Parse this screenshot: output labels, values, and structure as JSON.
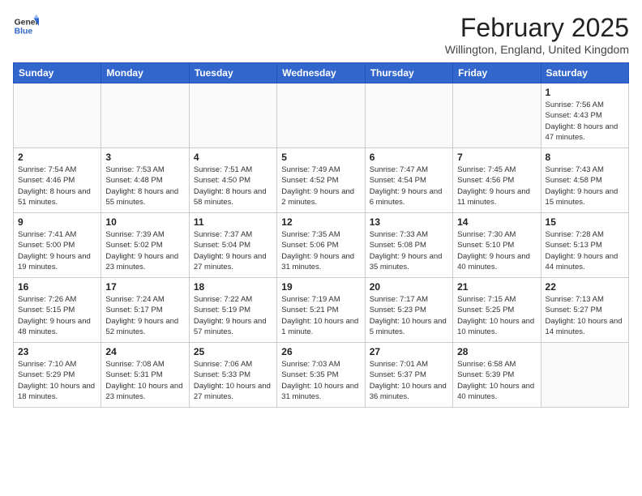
{
  "header": {
    "logo_general": "General",
    "logo_blue": "Blue",
    "title": "February 2025",
    "subtitle": "Willington, England, United Kingdom"
  },
  "days_of_week": [
    "Sunday",
    "Monday",
    "Tuesday",
    "Wednesday",
    "Thursday",
    "Friday",
    "Saturday"
  ],
  "weeks": [
    [
      {
        "day": "",
        "info": ""
      },
      {
        "day": "",
        "info": ""
      },
      {
        "day": "",
        "info": ""
      },
      {
        "day": "",
        "info": ""
      },
      {
        "day": "",
        "info": ""
      },
      {
        "day": "",
        "info": ""
      },
      {
        "day": "1",
        "info": "Sunrise: 7:56 AM\nSunset: 4:43 PM\nDaylight: 8 hours and 47 minutes."
      }
    ],
    [
      {
        "day": "2",
        "info": "Sunrise: 7:54 AM\nSunset: 4:46 PM\nDaylight: 8 hours and 51 minutes."
      },
      {
        "day": "3",
        "info": "Sunrise: 7:53 AM\nSunset: 4:48 PM\nDaylight: 8 hours and 55 minutes."
      },
      {
        "day": "4",
        "info": "Sunrise: 7:51 AM\nSunset: 4:50 PM\nDaylight: 8 hours and 58 minutes."
      },
      {
        "day": "5",
        "info": "Sunrise: 7:49 AM\nSunset: 4:52 PM\nDaylight: 9 hours and 2 minutes."
      },
      {
        "day": "6",
        "info": "Sunrise: 7:47 AM\nSunset: 4:54 PM\nDaylight: 9 hours and 6 minutes."
      },
      {
        "day": "7",
        "info": "Sunrise: 7:45 AM\nSunset: 4:56 PM\nDaylight: 9 hours and 11 minutes."
      },
      {
        "day": "8",
        "info": "Sunrise: 7:43 AM\nSunset: 4:58 PM\nDaylight: 9 hours and 15 minutes."
      }
    ],
    [
      {
        "day": "9",
        "info": "Sunrise: 7:41 AM\nSunset: 5:00 PM\nDaylight: 9 hours and 19 minutes."
      },
      {
        "day": "10",
        "info": "Sunrise: 7:39 AM\nSunset: 5:02 PM\nDaylight: 9 hours and 23 minutes."
      },
      {
        "day": "11",
        "info": "Sunrise: 7:37 AM\nSunset: 5:04 PM\nDaylight: 9 hours and 27 minutes."
      },
      {
        "day": "12",
        "info": "Sunrise: 7:35 AM\nSunset: 5:06 PM\nDaylight: 9 hours and 31 minutes."
      },
      {
        "day": "13",
        "info": "Sunrise: 7:33 AM\nSunset: 5:08 PM\nDaylight: 9 hours and 35 minutes."
      },
      {
        "day": "14",
        "info": "Sunrise: 7:30 AM\nSunset: 5:10 PM\nDaylight: 9 hours and 40 minutes."
      },
      {
        "day": "15",
        "info": "Sunrise: 7:28 AM\nSunset: 5:13 PM\nDaylight: 9 hours and 44 minutes."
      }
    ],
    [
      {
        "day": "16",
        "info": "Sunrise: 7:26 AM\nSunset: 5:15 PM\nDaylight: 9 hours and 48 minutes."
      },
      {
        "day": "17",
        "info": "Sunrise: 7:24 AM\nSunset: 5:17 PM\nDaylight: 9 hours and 52 minutes."
      },
      {
        "day": "18",
        "info": "Sunrise: 7:22 AM\nSunset: 5:19 PM\nDaylight: 9 hours and 57 minutes."
      },
      {
        "day": "19",
        "info": "Sunrise: 7:19 AM\nSunset: 5:21 PM\nDaylight: 10 hours and 1 minute."
      },
      {
        "day": "20",
        "info": "Sunrise: 7:17 AM\nSunset: 5:23 PM\nDaylight: 10 hours and 5 minutes."
      },
      {
        "day": "21",
        "info": "Sunrise: 7:15 AM\nSunset: 5:25 PM\nDaylight: 10 hours and 10 minutes."
      },
      {
        "day": "22",
        "info": "Sunrise: 7:13 AM\nSunset: 5:27 PM\nDaylight: 10 hours and 14 minutes."
      }
    ],
    [
      {
        "day": "23",
        "info": "Sunrise: 7:10 AM\nSunset: 5:29 PM\nDaylight: 10 hours and 18 minutes."
      },
      {
        "day": "24",
        "info": "Sunrise: 7:08 AM\nSunset: 5:31 PM\nDaylight: 10 hours and 23 minutes."
      },
      {
        "day": "25",
        "info": "Sunrise: 7:06 AM\nSunset: 5:33 PM\nDaylight: 10 hours and 27 minutes."
      },
      {
        "day": "26",
        "info": "Sunrise: 7:03 AM\nSunset: 5:35 PM\nDaylight: 10 hours and 31 minutes."
      },
      {
        "day": "27",
        "info": "Sunrise: 7:01 AM\nSunset: 5:37 PM\nDaylight: 10 hours and 36 minutes."
      },
      {
        "day": "28",
        "info": "Sunrise: 6:58 AM\nSunset: 5:39 PM\nDaylight: 10 hours and 40 minutes."
      },
      {
        "day": "",
        "info": ""
      }
    ]
  ]
}
